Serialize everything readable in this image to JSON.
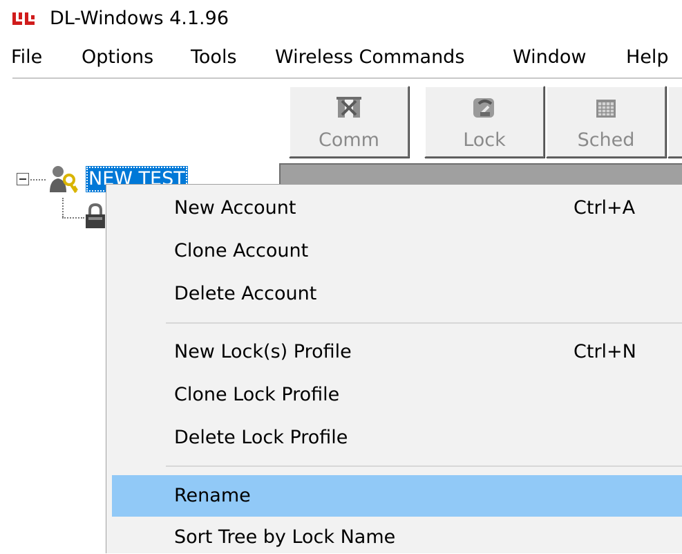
{
  "window": {
    "title": "DL-Windows 4.1.96"
  },
  "menubar": {
    "items": [
      "File",
      "Options",
      "Tools",
      "Wireless Commands",
      "Window",
      "Help"
    ]
  },
  "toolbar": {
    "buttons": [
      {
        "label": "Comm",
        "icon": "comm-icon"
      },
      {
        "label": "Lock",
        "icon": "lock-icon"
      },
      {
        "label": "Sched",
        "icon": "schedule-icon"
      }
    ]
  },
  "tree": {
    "root_label": "NEW TEST",
    "root_icon": "account-icon",
    "child_icon": "lock-profile-icon"
  },
  "context_menu": {
    "items": [
      {
        "label": "New Account",
        "shortcut": "Ctrl+A"
      },
      {
        "label": "Clone Account",
        "shortcut": ""
      },
      {
        "label": "Delete Account",
        "shortcut": ""
      },
      {
        "label": "New Lock(s) Profile",
        "shortcut": "Ctrl+N"
      },
      {
        "label": "Clone Lock Profile",
        "shortcut": ""
      },
      {
        "label": "Delete Lock Profile",
        "shortcut": ""
      },
      {
        "label": "Rename",
        "shortcut": ""
      },
      {
        "label": "Sort Tree by Lock Name",
        "shortcut": ""
      }
    ],
    "highlighted": "Rename"
  },
  "colors": {
    "selection": "#0078d7",
    "menu_hover": "#91c9f7",
    "menu_background": "#f2f2f2",
    "disabled_text": "#8a8a8a"
  }
}
